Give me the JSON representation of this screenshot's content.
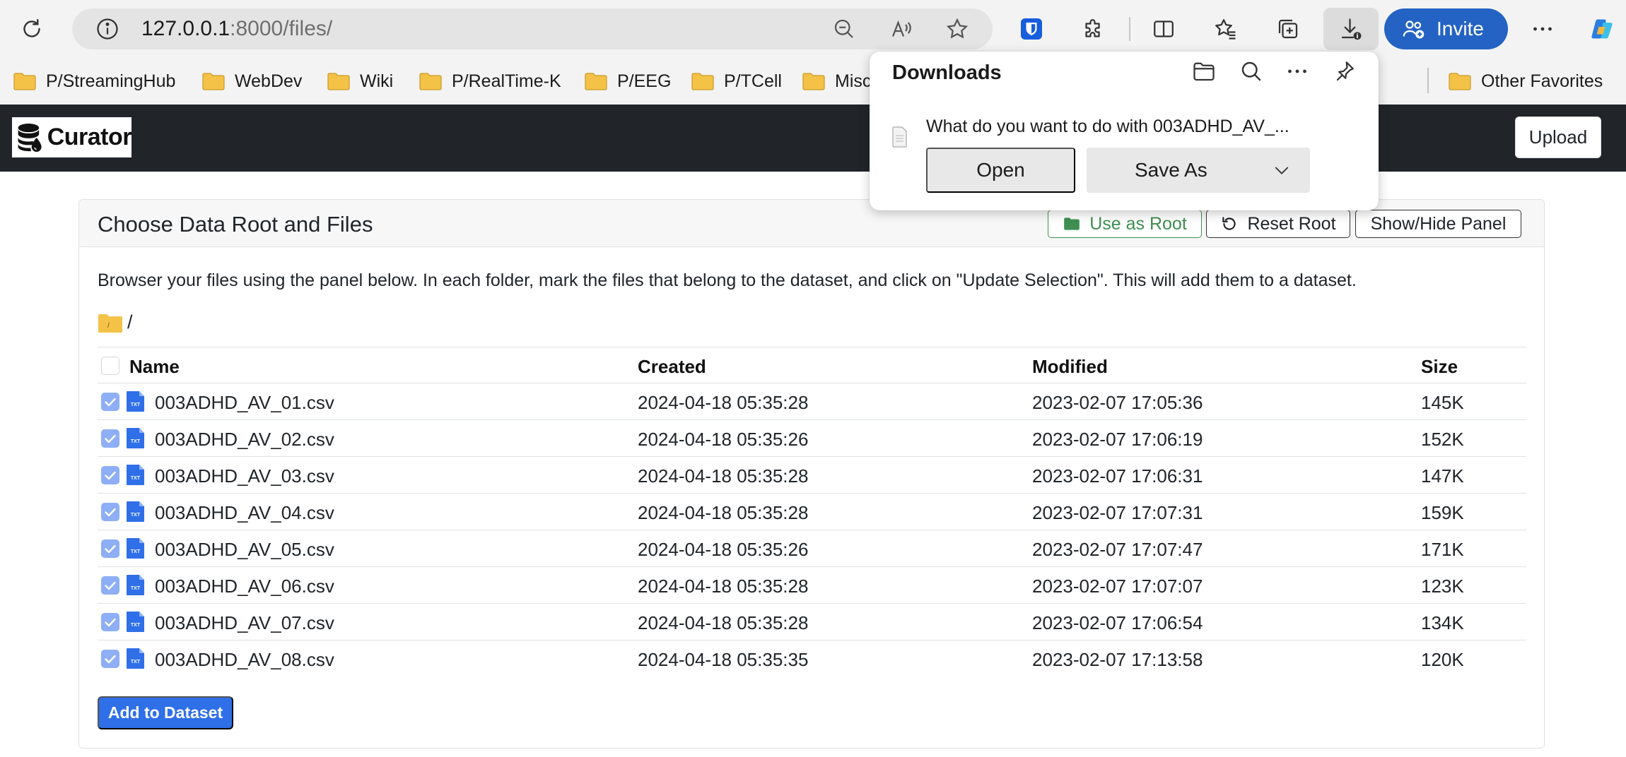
{
  "browser": {
    "address_host": "127.0.0.1",
    "address_path": ":8000/files/",
    "invite_label": "Invite",
    "bookmarks": [
      {
        "label": "P/StreamingHub"
      },
      {
        "label": "WebDev"
      },
      {
        "label": "Wiki"
      },
      {
        "label": "P/RealTime-K"
      },
      {
        "label": "P/EEG"
      },
      {
        "label": "P/TCell"
      },
      {
        "label": "Misc"
      }
    ],
    "other_favorites": "Other Favorites"
  },
  "downloads": {
    "title": "Downloads",
    "question": "What do you want to do with 003ADHD_AV_...",
    "open_label": "Open",
    "save_as_label": "Save As"
  },
  "navbar": {
    "logo_text": "Curator",
    "upload_label": "Upload"
  },
  "card": {
    "title": "Choose Data Root and Files",
    "use_as_root": "Use as Root",
    "reset_root": "Reset Root",
    "show_hide": "Show/Hide Panel",
    "instructions": "Browser your files using the panel below. In each folder, mark the files that belong to the dataset, and click on \"Update Selection\". This will add them to a dataset.",
    "breadcrumb": "/",
    "breadcrumb_icon_text": "/",
    "add_to_dataset": "Add to Dataset"
  },
  "table": {
    "columns": {
      "name": "Name",
      "created": "Created",
      "modified": "Modified",
      "size": "Size"
    },
    "file_icon_text": "TXT",
    "rows": [
      {
        "name": "003ADHD_AV_01.csv",
        "created": "2024-04-18 05:35:28",
        "modified": "2023-02-07 17:05:36",
        "size": "145K",
        "checked": true
      },
      {
        "name": "003ADHD_AV_02.csv",
        "created": "2024-04-18 05:35:26",
        "modified": "2023-02-07 17:06:19",
        "size": "152K",
        "checked": true
      },
      {
        "name": "003ADHD_AV_03.csv",
        "created": "2024-04-18 05:35:28",
        "modified": "2023-02-07 17:06:31",
        "size": "147K",
        "checked": true
      },
      {
        "name": "003ADHD_AV_04.csv",
        "created": "2024-04-18 05:35:28",
        "modified": "2023-02-07 17:07:31",
        "size": "159K",
        "checked": true
      },
      {
        "name": "003ADHD_AV_05.csv",
        "created": "2024-04-18 05:35:26",
        "modified": "2023-02-07 17:07:47",
        "size": "171K",
        "checked": true
      },
      {
        "name": "003ADHD_AV_06.csv",
        "created": "2024-04-18 05:35:28",
        "modified": "2023-02-07 17:07:07",
        "size": "123K",
        "checked": true
      },
      {
        "name": "003ADHD_AV_07.csv",
        "created": "2024-04-18 05:35:28",
        "modified": "2023-02-07 17:06:54",
        "size": "134K",
        "checked": true
      },
      {
        "name": "003ADHD_AV_08.csv",
        "created": "2024-04-18 05:35:35",
        "modified": "2023-02-07 17:13:58",
        "size": "120K",
        "checked": true
      }
    ]
  }
}
